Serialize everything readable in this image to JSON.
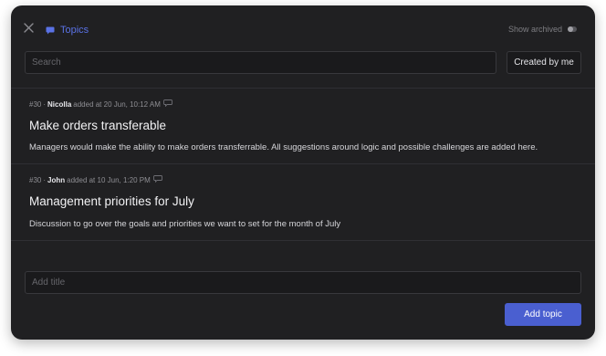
{
  "header": {
    "title": "Topics",
    "show_archived_label": "Show archived",
    "show_archived_on": false
  },
  "search": {
    "placeholder": "Search",
    "value": ""
  },
  "filter": {
    "created_by_me_label": "Created by me"
  },
  "topics": [
    {
      "number": "#30",
      "separator": "·",
      "author": "Nicolla",
      "added_text": "added at 20 Jun, 10:12 AM",
      "title": "Make orders transferable",
      "description": "Managers would make the ability to make orders transferrable. All suggestions around logic and possible challenges are added here."
    },
    {
      "number": "#30",
      "separator": "·",
      "author": "John",
      "added_text": "added at 10 Jun, 1:20 PM",
      "title": "Management priorities for July",
      "description": "Discussion to go over the goals and priorities we want to set for the month of July"
    }
  ],
  "new_topic": {
    "title_placeholder": "Add title",
    "title_value": "",
    "add_button_label": "Add topic"
  },
  "icons": {
    "close": "close-icon",
    "topics": "chat-bubble-icon",
    "comment": "comment-icon"
  },
  "colors": {
    "panel_bg": "#202022",
    "accent": "#5a72e6",
    "primary_button": "#4a5fd0"
  }
}
